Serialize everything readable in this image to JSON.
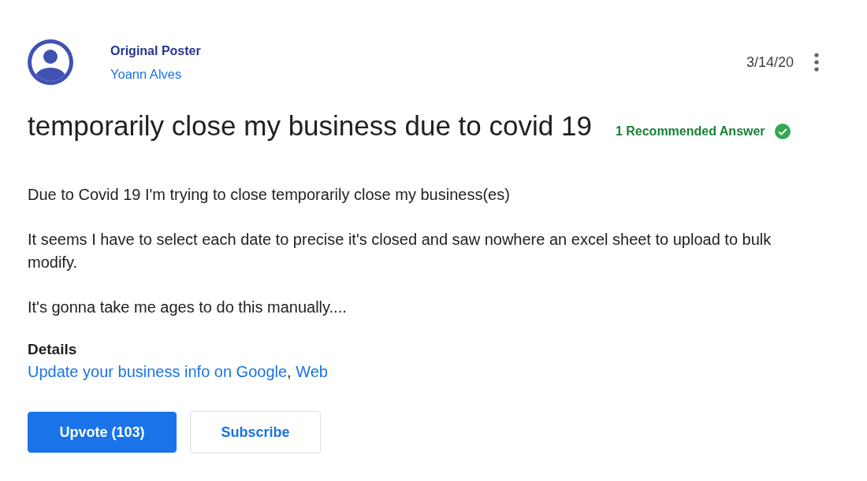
{
  "post": {
    "author": {
      "role": "Original Poster",
      "name": "Yoann Alves"
    },
    "date": "3/14/20",
    "title": "temporarily close my business due to covid 19",
    "recommended_answers": {
      "label": "1 Recommended Answer"
    },
    "body": [
      "Due to Covid 19 I'm trying to close temporarily close my business(es)",
      "It seems I have to select each date to precise it's closed and saw nowhere an excel sheet to upload to bulk modify.",
      "It's gonna take me ages to do this manually...."
    ],
    "details": {
      "heading": "Details",
      "links": [
        "Update your business info on Google",
        "Web"
      ],
      "separator": ", "
    }
  },
  "buttons": [
    {
      "label": "Upvote (103)",
      "kind": "primary"
    },
    {
      "label": "Subscribe",
      "kind": "secondary"
    }
  ]
}
